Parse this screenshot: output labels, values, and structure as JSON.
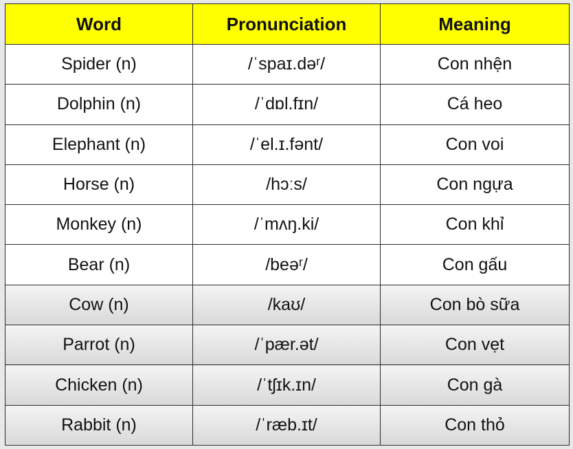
{
  "headers": {
    "word": "Word",
    "pronunciation": "Pronunciation",
    "meaning": "Meaning"
  },
  "rows": [
    {
      "word": "Spider (n)",
      "pronunciation": "/ˈspaɪ.dəʳ/",
      "meaning": "Con nhện"
    },
    {
      "word": "Dolphin (n)",
      "pronunciation": "/ˈdɒl.fɪn/",
      "meaning": "Cá heo"
    },
    {
      "word": "Elephant (n)",
      "pronunciation": "/ˈel.ɪ.fənt/",
      "meaning": "Con voi"
    },
    {
      "word": "Horse (n)",
      "pronunciation": "/hɔːs/",
      "meaning": "Con ngựa"
    },
    {
      "word": "Monkey (n)",
      "pronunciation": "/ˈmʌŋ.ki/",
      "meaning": "Con khỉ"
    },
    {
      "word": "Bear (n)",
      "pronunciation": "/beəʳ/",
      "meaning": "Con gấu"
    },
    {
      "word": "Cow (n)",
      "pronunciation": "/kaʊ/",
      "meaning": "Con bò sữa"
    },
    {
      "word": "Parrot (n)",
      "pronunciation": "/ˈpær.ət/",
      "meaning": "Con vẹt"
    },
    {
      "word": "Chicken (n)",
      "pronunciation": "/ˈtʃɪk.ɪn/",
      "meaning": "Con gà"
    },
    {
      "word": "Rabbit (n)",
      "pronunciation": "/ˈræb.ɪt/",
      "meaning": "Con thỏ"
    }
  ],
  "colors": {
    "header_background": "#ffff00",
    "border": "#2a2a2a",
    "row_background": "#ffffff",
    "shaded_row_background": "#e6e6e6"
  }
}
